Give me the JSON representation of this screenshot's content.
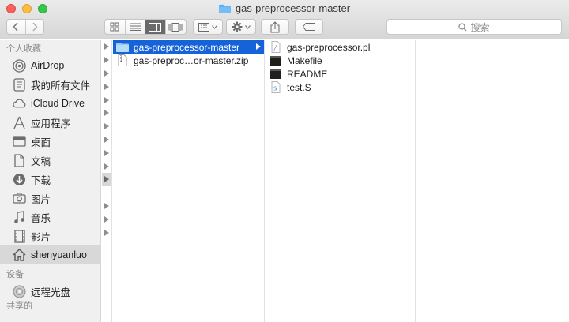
{
  "window": {
    "title": "gas-preprocessor-master"
  },
  "toolbar": {
    "search_placeholder": "搜索",
    "back_icon": "chevron-left-icon",
    "forward_icon": "chevron-right-icon"
  },
  "sidebar": {
    "favorites_header": "个人收藏",
    "favorites": [
      {
        "label": "AirDrop",
        "icon": "airdrop-icon"
      },
      {
        "label": "我的所有文件",
        "icon": "all-files-icon"
      },
      {
        "label": "iCloud Drive",
        "icon": "cloud-icon"
      },
      {
        "label": "应用程序",
        "icon": "applications-icon"
      },
      {
        "label": "桌面",
        "icon": "desktop-icon"
      },
      {
        "label": "文稿",
        "icon": "documents-icon"
      },
      {
        "label": "下载",
        "icon": "downloads-icon"
      },
      {
        "label": "图片",
        "icon": "camera-icon"
      },
      {
        "label": "音乐",
        "icon": "music-icon"
      },
      {
        "label": "影片",
        "icon": "movies-icon"
      },
      {
        "label": "shenyuanluo",
        "icon": "home-icon"
      }
    ],
    "devices_header": "设备",
    "devices": [
      {
        "label": "远程光盘",
        "icon": "disc-icon"
      }
    ],
    "shared_header": "共享的"
  },
  "column2": {
    "items": [
      {
        "label": "gas-preprocessor-master",
        "icon": "folder-icon",
        "selected": true
      },
      {
        "label": "gas-preproc…or-master.zip",
        "icon": "zip-icon",
        "selected": false
      }
    ]
  },
  "column3": {
    "items": [
      {
        "label": "gas-preprocessor.pl",
        "icon": "script-icon"
      },
      {
        "label": "Makefile",
        "icon": "terminal-icon"
      },
      {
        "label": "README",
        "icon": "terminal-icon"
      },
      {
        "label": "test.S",
        "icon": "source-file-icon"
      }
    ]
  },
  "colors": {
    "selection": "#1663d9",
    "folder": "#4aa3f0",
    "sidebar_bg": "#f0f0f0"
  }
}
